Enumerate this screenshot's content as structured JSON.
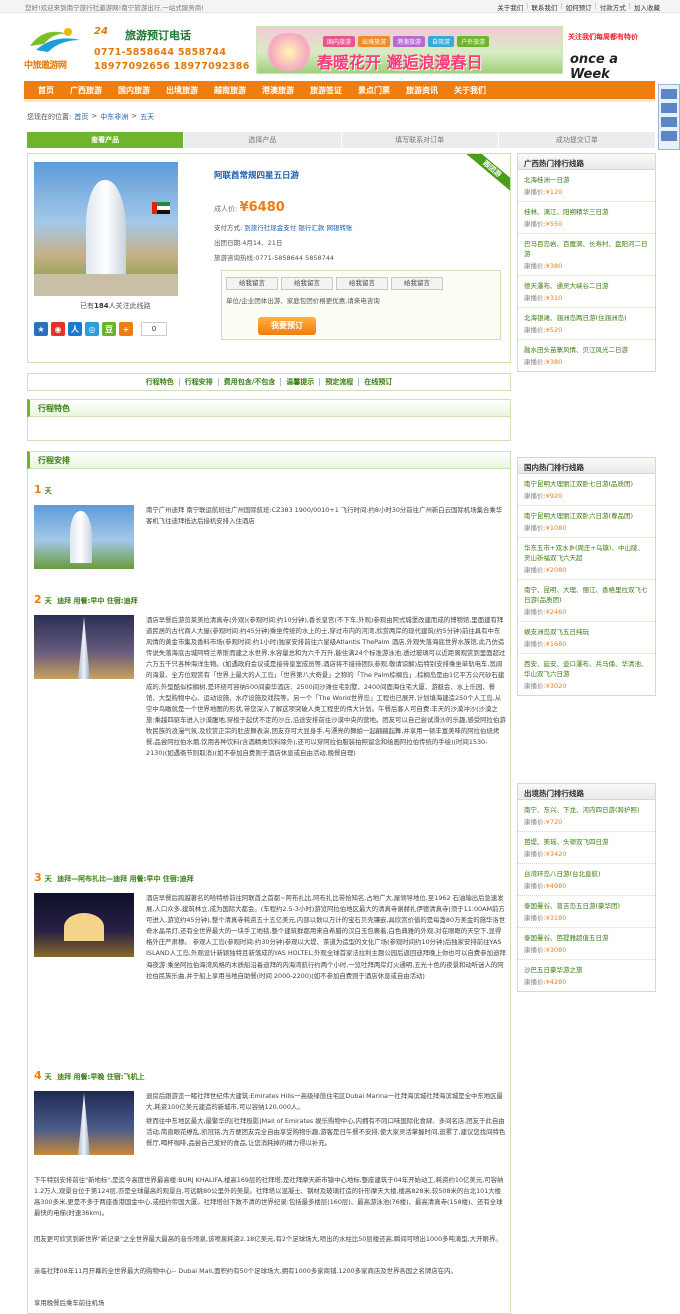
{
  "topbar": {
    "welcome": "您好!欢迎来到南宁旅行社遨游网!南宁旅游出行,一站式服务商!",
    "links": [
      "关于我们",
      "联系我们",
      "如何预订",
      "付款方式",
      "加入收藏"
    ]
  },
  "header": {
    "logo_text": "中旅遨游网",
    "phone_24": "24",
    "phone_title": "旅游预订电话",
    "phone_1": "0771-5858644 5858744",
    "phone_2": "18977092656 18977092386",
    "banner_chips": [
      "国内旅游",
      "出境旅游",
      "港澳旅游",
      "自驾游",
      "户外旅游"
    ],
    "banner_slogan": "春暖花开 邂逅浪漫春日",
    "promo_1": "关注我们每周都有特价",
    "promo_2": "once a Week"
  },
  "nav": {
    "items": [
      "首页",
      "广西旅游",
      "国内旅游",
      "出境旅游",
      "越南旅游",
      "港澳旅游",
      "旅游签证",
      "景点门票",
      "旅游资讯",
      "关于我们"
    ]
  },
  "breadcrumb": {
    "label": "您现在的位置:",
    "items": [
      "首页",
      "中东非洲",
      "五天"
    ],
    "sep": ">"
  },
  "steps": [
    "查看产品",
    "选择产品",
    "填写联系对订单",
    "成功提交订单"
  ],
  "product": {
    "badge": "跟团游",
    "title": "阿联酋常规四星五日游",
    "price_label": "成人价:",
    "price": "¥6480",
    "pay_label": "支付方式:",
    "pay_methods": [
      "到旅行社现金支付",
      "银行汇款",
      "网银转账"
    ],
    "date_label": "出团日期:",
    "dates": "4月14、21日",
    "hotline_label": "旅游咨询热线:",
    "hotline": "0771-5858644 5858744",
    "follow_prefix": "已有",
    "follow_count": "184",
    "follow_suffix": "人关注此线路",
    "share_count": "0",
    "msg_buttons": [
      "给我留言",
      "给我留言",
      "给我留言",
      "给我留言"
    ],
    "msg_note": "单位/企业团体出游、家庭包团价格更优惠,请来电咨询",
    "order_button": "我要预订"
  },
  "tabs": [
    "行程特色",
    "行程安排",
    "费用包含/不包含",
    "温馨提示",
    "预定流程",
    "在线预订"
  ],
  "sections": {
    "features": "行程特色",
    "itinerary": "行程安排"
  },
  "days": [
    {
      "n": "1",
      "unit": "天",
      "title": "",
      "text": "南宁广州迪拜 南宁联运航班往广州国际航班:CZ383 1900/0010+1 飞行时间:约8小时30分前往广州新白云国际机场集合乘华客机飞往迪拜抵达后接机安排入住酒店"
    },
    {
      "n": "2",
      "unit": "天",
      "title": "迪拜 用餐:早中 住宿:迪拜",
      "text": "酒店早餐后游览莱美拉清真寺(外观)(参观时间:约10分钟),香长皇宫(不下车,外观)参观由阿式城堡改建而成的博物馆,里面建有拜道民居的古代商人大屋(参观时间:约45分钟)乘坐传统的水上的士,穿过市内的河湾,欣赏两岸的现代建筑(约5分钟)前往具有中东风情的黄金市集及香料市场(参观时间:约1小时)独家安排前往六星级Atlantis ThePalm 酒店,外观失落海底世界水族馆,此乃仿造传说失落海底古城阿特兰蒂斯而建之水世界,水容量总和为六千万升,能住满24个标准游泳池,透过玻璃可以近距离观赏到里面超过六万五千只各种海洋生物。(如遇政府会议或是接待皇室成员等,酒店将不接待团队参观,敬请谅解)后特别安排乘坐单轨电车,宽阔的海景、全方位观赏有「世界上最大的人工岛」「世界第八大奇景」之称的「The Palm棕榈岛」,棕榈岛是由1亿平方公尺砂石建成的,外型酷似棕榈树,是环绕可容纳500间豪华酒店、2500间沙滩住宅别墅、2400间面海住宅大厦、游艇会、水上乐园、餐馆、大型购物中心、运动设施、水疗设施及戏院等。另一个「The World世界岛」工程也已展开,计划填海建造250个人工岛,从空中鸟瞰就是一个世界地图的形状,带您深入了解这项突破人类工程史的伟大计划。午餐后客人可自费:丰天的沙漠冲沙(沙漠之旅:乘越四驱车进入沙漠腹地,穿梭于起伏不定的沙丘,沿途安排前往沙漠中央的营地。团友可以自己尝试滑沙的乐趣,感受阿拉伯游牧民族的浪漫气氛,及欣赏正宗的肚皮舞表演,团友亦可大显身手,与漂亮的舞娘一起翩翩起舞,并享用一顿丰富美味的阿拉伯烧烤餐,品尝阿拉伯水烟,饮用各种饮料(含酒精类饮料除外),还可以穿阿拉伯服装拍照留念和绘画阿拉伯传统的手绘)(时间1530-2130)(如遇斋节则取消)(如不参加自费则于酒店休息或自由活动,晚餐自理)"
    },
    {
      "n": "3",
      "unit": "天",
      "title": "迪拜—阿布扎比—迪拜 用餐:早中 住宿:迪拜",
      "text": "酒店早餐后跨越著名的哈特桥前往阿联酋之首都~阿布扎比,阿布扎比带拾知名,占地广大,屋领导地位,至1962 石油输出后急速发展,人口众多,建筑林立,成为国际大都会。(车程约2.5-3小时)游览阿拉伯地区最大的清真寺谢赫扎伊德清真寺(须于11:00AM前方可进入,游览约45分钟),整个清真寺耗资五十五亿美元,内部以数以万计的宝石贝壳镶嵌,具欣赏价值的是每盏80万美金的施华洛世奇水晶吊灯,还有全世界最大的一块手工地毯,整个建筑群都用来自希腊的汉白玉包裹着,白色典雅的外观,对在眼眶的天空下,显得格外庄严肃穆。 参观人工岛(参观时间:约30分钟)参观以大堤、茶道为造型的文化广场(参观时间约10分钟)后独家安排前往YAS ISLAND人工岛,外观设计新颖独特且新落成的YAS HOLTEL;外观全球首家法拉利主题公园后返回迪拜晚上你也可以自费参加迪拜海夜游:乘坐阿拉伯海湾风格的木质船沿着迪拜的内海湾航行约两个小时,一览吐拜两岸灯火通明,五光十色的夜景和动听迷人的阿拉伯民族乐曲,并于船上享用当地自助餐(时间 2000-2200)(如不参加自费则于酒店休息或自由活动)"
    },
    {
      "n": "4",
      "unit": "天",
      "title": "迪拜 用餐:早晚 住宿:飞机上",
      "text1": "退房后跟游览一睹社拜世纪伟大建筑:Emirates Hills一高级绿茵住宅区Dubai Marina一社拜海滨城社拜海滨城是全中东地区最大,耗资100亿美元建造的新城市,可以容纳120,000人。",
      "text2": "继而往中东地区最大,最繁华的[社拜极影]Mall of Emirates 娱乐购物中心,内拥有不同口味国际化食肆、多间名店,团友于此自由活动,简直眼花缭乱,凯冠铭,为方便团友完全自由享受购物乐趣,游客是日午餐不安排,使大家灵活掌握时间,逛累了,建议您找间特色餐厅,喝杯咖啡,品尝自己爱好的食品,让您消耗掉的精力得以补充。",
      "text3": "下午特别安排前往\"新地标\",是迄今高度世界最高楼:BURJ KHALIFA,楼高169层的社拜塔,是社拜摩天新市镇中心地标,整座建筑于04年开始动工,耗资约10亿美元,可容纳1.2万人,观景台位于第124层,亦是全球最高的观景台,可远眺80公里外的美景。社拜塔以混凝土、钢材及玻璃打造的针形摩天大楼,楼高828米,较508米的台北101大楼高300多米,更是不多于两座香港国金中心,或纽约帝国大厦。社拜塔创下数不清的世界纪录:包括最多楼层(160层)、最高游泳池(76楼)、最高清真寺(158楼)、还有全球最快的电梯(时速36km)。",
      "text4": "团友更可欣赏到新世界\"新记录\"之全世界最大最高的音乐喷泉,该喷泉耗资2.18亿美元,有2个足球场大,喷出的水柱比50层楼还高,瞬间可喷出1000多吨滴型,大开眼界。",
      "text5": "亲临社拜08年11月开幕的全世界最大的购物中心-- Dubai Mall,面积约有50个足球场大,拥有1000多家商铺,1200多家商店及世界各国之名牌店在内。",
      "text6": "享用晚餐后乘车前往机场"
    }
  ],
  "sidebar": {
    "guangxi": {
      "title": "广西热门排行线路",
      "routes": [
        {
          "name": "北海桂洲一日游",
          "price": "¥120"
        },
        {
          "name": "桂林、漓江、阳朔精华三日游",
          "price": "¥550"
        },
        {
          "name": "巴马百岛岩、百魔洞、长寿村、盘阳河二日游",
          "price": "¥380"
        },
        {
          "name": "德天瀑布、通灵大峡谷二日游",
          "price": "¥310"
        },
        {
          "name": "北海银滩、涠洲岛两日游(住涠洲岛)",
          "price": "¥520"
        },
        {
          "name": "融水田头苗寨风情、贝江风光二日游",
          "price": "¥380"
        }
      ]
    },
    "domestic": {
      "title": "国内热门排行线路",
      "routes": [
        {
          "name": "南宁昆明大理丽江双卧七日游(品质团)",
          "price": "¥920"
        },
        {
          "name": "南宁昆明大理丽江双卧六日游(尊品团)",
          "price": "¥1080"
        },
        {
          "name": "华东五市+双水乡(周庄+乌镇)、中山陵、灵山祈福双飞六天超",
          "price": "¥2080"
        },
        {
          "name": "南宁、昆明、大理、丽江、香格里拉双飞七日游(品质团)",
          "price": "¥2460"
        },
        {
          "name": "蜈支洲岛双飞五日纯玩",
          "price": "¥1680"
        },
        {
          "name": "西安、延安、壶口瀑布、兵马俑、华清池、华山双飞六日游",
          "price": "¥3020"
        }
      ]
    },
    "outbound": {
      "title": "出境热门排行线路",
      "routes": [
        {
          "name": "南宁、东兴、下龙、河内四日游(跨护照)",
          "price": "¥720"
        },
        {
          "name": "芭堤、美瑶、头顿双飞四日游",
          "price": "¥3420"
        },
        {
          "name": "台湾环岛八日游(台北直航)",
          "price": "¥4980"
        },
        {
          "name": "泰国曼谷、普吉岛五日游(豪华团)",
          "price": "¥3180"
        },
        {
          "name": "泰国曼谷、芭提雅超值五日游",
          "price": "¥3080"
        },
        {
          "name": "沙巴五日豪华游之旅",
          "price": "¥4280"
        }
      ]
    },
    "price_label": "康播价:"
  },
  "colors": {
    "accent_orange": "#f07d0f",
    "accent_green": "#6fb52c",
    "link_blue": "#1a5fa8"
  }
}
